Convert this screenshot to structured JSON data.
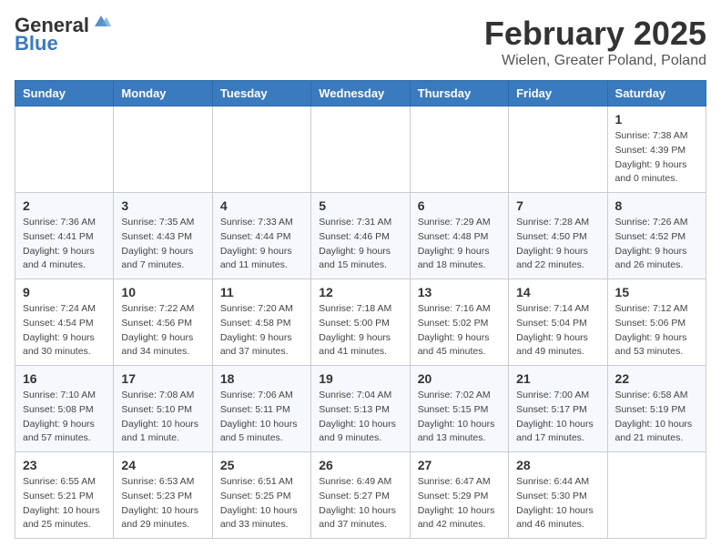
{
  "header": {
    "logo_line1": "General",
    "logo_line2": "Blue",
    "month_title": "February 2025",
    "location": "Wielen, Greater Poland, Poland"
  },
  "days_of_week": [
    "Sunday",
    "Monday",
    "Tuesday",
    "Wednesday",
    "Thursday",
    "Friday",
    "Saturday"
  ],
  "weeks": [
    [
      {
        "day": "",
        "info": ""
      },
      {
        "day": "",
        "info": ""
      },
      {
        "day": "",
        "info": ""
      },
      {
        "day": "",
        "info": ""
      },
      {
        "day": "",
        "info": ""
      },
      {
        "day": "",
        "info": ""
      },
      {
        "day": "1",
        "info": "Sunrise: 7:38 AM\nSunset: 4:39 PM\nDaylight: 9 hours and 0 minutes."
      }
    ],
    [
      {
        "day": "2",
        "info": "Sunrise: 7:36 AM\nSunset: 4:41 PM\nDaylight: 9 hours and 4 minutes."
      },
      {
        "day": "3",
        "info": "Sunrise: 7:35 AM\nSunset: 4:43 PM\nDaylight: 9 hours and 7 minutes."
      },
      {
        "day": "4",
        "info": "Sunrise: 7:33 AM\nSunset: 4:44 PM\nDaylight: 9 hours and 11 minutes."
      },
      {
        "day": "5",
        "info": "Sunrise: 7:31 AM\nSunset: 4:46 PM\nDaylight: 9 hours and 15 minutes."
      },
      {
        "day": "6",
        "info": "Sunrise: 7:29 AM\nSunset: 4:48 PM\nDaylight: 9 hours and 18 minutes."
      },
      {
        "day": "7",
        "info": "Sunrise: 7:28 AM\nSunset: 4:50 PM\nDaylight: 9 hours and 22 minutes."
      },
      {
        "day": "8",
        "info": "Sunrise: 7:26 AM\nSunset: 4:52 PM\nDaylight: 9 hours and 26 minutes."
      }
    ],
    [
      {
        "day": "9",
        "info": "Sunrise: 7:24 AM\nSunset: 4:54 PM\nDaylight: 9 hours and 30 minutes."
      },
      {
        "day": "10",
        "info": "Sunrise: 7:22 AM\nSunset: 4:56 PM\nDaylight: 9 hours and 34 minutes."
      },
      {
        "day": "11",
        "info": "Sunrise: 7:20 AM\nSunset: 4:58 PM\nDaylight: 9 hours and 37 minutes."
      },
      {
        "day": "12",
        "info": "Sunrise: 7:18 AM\nSunset: 5:00 PM\nDaylight: 9 hours and 41 minutes."
      },
      {
        "day": "13",
        "info": "Sunrise: 7:16 AM\nSunset: 5:02 PM\nDaylight: 9 hours and 45 minutes."
      },
      {
        "day": "14",
        "info": "Sunrise: 7:14 AM\nSunset: 5:04 PM\nDaylight: 9 hours and 49 minutes."
      },
      {
        "day": "15",
        "info": "Sunrise: 7:12 AM\nSunset: 5:06 PM\nDaylight: 9 hours and 53 minutes."
      }
    ],
    [
      {
        "day": "16",
        "info": "Sunrise: 7:10 AM\nSunset: 5:08 PM\nDaylight: 9 hours and 57 minutes."
      },
      {
        "day": "17",
        "info": "Sunrise: 7:08 AM\nSunset: 5:10 PM\nDaylight: 10 hours and 1 minute."
      },
      {
        "day": "18",
        "info": "Sunrise: 7:06 AM\nSunset: 5:11 PM\nDaylight: 10 hours and 5 minutes."
      },
      {
        "day": "19",
        "info": "Sunrise: 7:04 AM\nSunset: 5:13 PM\nDaylight: 10 hours and 9 minutes."
      },
      {
        "day": "20",
        "info": "Sunrise: 7:02 AM\nSunset: 5:15 PM\nDaylight: 10 hours and 13 minutes."
      },
      {
        "day": "21",
        "info": "Sunrise: 7:00 AM\nSunset: 5:17 PM\nDaylight: 10 hours and 17 minutes."
      },
      {
        "day": "22",
        "info": "Sunrise: 6:58 AM\nSunset: 5:19 PM\nDaylight: 10 hours and 21 minutes."
      }
    ],
    [
      {
        "day": "23",
        "info": "Sunrise: 6:55 AM\nSunset: 5:21 PM\nDaylight: 10 hours and 25 minutes."
      },
      {
        "day": "24",
        "info": "Sunrise: 6:53 AM\nSunset: 5:23 PM\nDaylight: 10 hours and 29 minutes."
      },
      {
        "day": "25",
        "info": "Sunrise: 6:51 AM\nSunset: 5:25 PM\nDaylight: 10 hours and 33 minutes."
      },
      {
        "day": "26",
        "info": "Sunrise: 6:49 AM\nSunset: 5:27 PM\nDaylight: 10 hours and 37 minutes."
      },
      {
        "day": "27",
        "info": "Sunrise: 6:47 AM\nSunset: 5:29 PM\nDaylight: 10 hours and 42 minutes."
      },
      {
        "day": "28",
        "info": "Sunrise: 6:44 AM\nSunset: 5:30 PM\nDaylight: 10 hours and 46 minutes."
      },
      {
        "day": "",
        "info": ""
      }
    ]
  ]
}
